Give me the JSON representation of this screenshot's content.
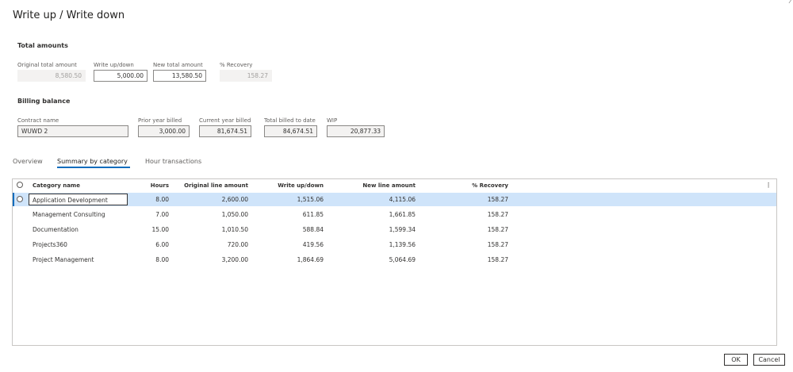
{
  "dialog": {
    "title": "Write up / Write down"
  },
  "total_amounts": {
    "heading": "Total amounts",
    "original_total": {
      "label": "Original total amount",
      "value": "8,580.50"
    },
    "write_up_down": {
      "label": "Write up/down",
      "value": "5,000.00"
    },
    "new_total": {
      "label": "New total amount",
      "value": "13,580.50"
    },
    "recovery": {
      "label": "% Recovery",
      "value": "158.27"
    }
  },
  "billing_balance": {
    "heading": "Billing balance",
    "contract_name": {
      "label": "Contract name",
      "value": "WUWD 2"
    },
    "prior_year_billed": {
      "label": "Prior year billed",
      "value": "3,000.00"
    },
    "current_year_billed": {
      "label": "Current year billed",
      "value": "81,674.51"
    },
    "total_billed_to_date": {
      "label": "Total billed to date",
      "value": "84,674.51"
    },
    "wip": {
      "label": "WIP",
      "value": "20,877.33"
    }
  },
  "tabs": [
    {
      "label": "Overview",
      "active": false
    },
    {
      "label": "Summary by category",
      "active": true
    },
    {
      "label": "Hour transactions",
      "active": false
    }
  ],
  "grid": {
    "columns": [
      "Category name",
      "Hours",
      "Original line amount",
      "Write up/down",
      "New line amount",
      "% Recovery"
    ],
    "rows": [
      {
        "category": "Application Development",
        "hours": "8.00",
        "original": "2,600.00",
        "write": "1,515.06",
        "new": "4,115.06",
        "recovery": "158.27"
      },
      {
        "category": "Management Consulting",
        "hours": "7.00",
        "original": "1,050.00",
        "write": "611.85",
        "new": "1,661.85",
        "recovery": "158.27"
      },
      {
        "category": "Documentation",
        "hours": "15.00",
        "original": "1,010.50",
        "write": "588.84",
        "new": "1,599.34",
        "recovery": "158.27"
      },
      {
        "category": "Projects360",
        "hours": "6.00",
        "original": "720.00",
        "write": "419.56",
        "new": "1,139.56",
        "recovery": "158.27"
      },
      {
        "category": "Project Management",
        "hours": "8.00",
        "original": "3,200.00",
        "write": "1,864.69",
        "new": "5,064.69",
        "recovery": "158.27"
      }
    ]
  },
  "buttons": {
    "ok": "OK",
    "cancel": "Cancel"
  }
}
